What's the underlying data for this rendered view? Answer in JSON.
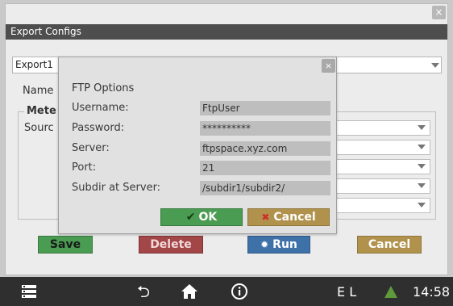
{
  "window": {
    "title": "Export Configs",
    "close_glyph": "×"
  },
  "background": {
    "config_select_value": "Export1",
    "name_label": "Name",
    "meteo_label": "Mete",
    "source_label": "Sourc"
  },
  "buttons": {
    "save": "Save",
    "delete": "Delete",
    "run": "Run",
    "cancel": "Cancel"
  },
  "dialog": {
    "close_glyph": "×",
    "title": "FTP Options",
    "rows": [
      {
        "label": "Username:",
        "value": "FtpUser"
      },
      {
        "label": "Password:",
        "value": "**********"
      },
      {
        "label": "Server:",
        "value": "ftpspace.xyz.com"
      },
      {
        "label": "Port:",
        "value": "21"
      },
      {
        "label": "Subdir at Server:",
        "value": "/subdir1/subdir2/"
      }
    ],
    "ok_label": "OK",
    "cancel_label": "Cancel"
  },
  "taskbar": {
    "status_letters": "E L",
    "clock": "14:58",
    "icons": [
      "menu-icon",
      "back-icon",
      "home-icon",
      "info-icon",
      "warning-icon"
    ]
  },
  "colors": {
    "save": "#4a9c52",
    "delete": "#a34648",
    "run": "#3e71a8",
    "cancel": "#b0924c",
    "taskbar": "#2f2f2f",
    "warning": "#5e9a3a"
  }
}
